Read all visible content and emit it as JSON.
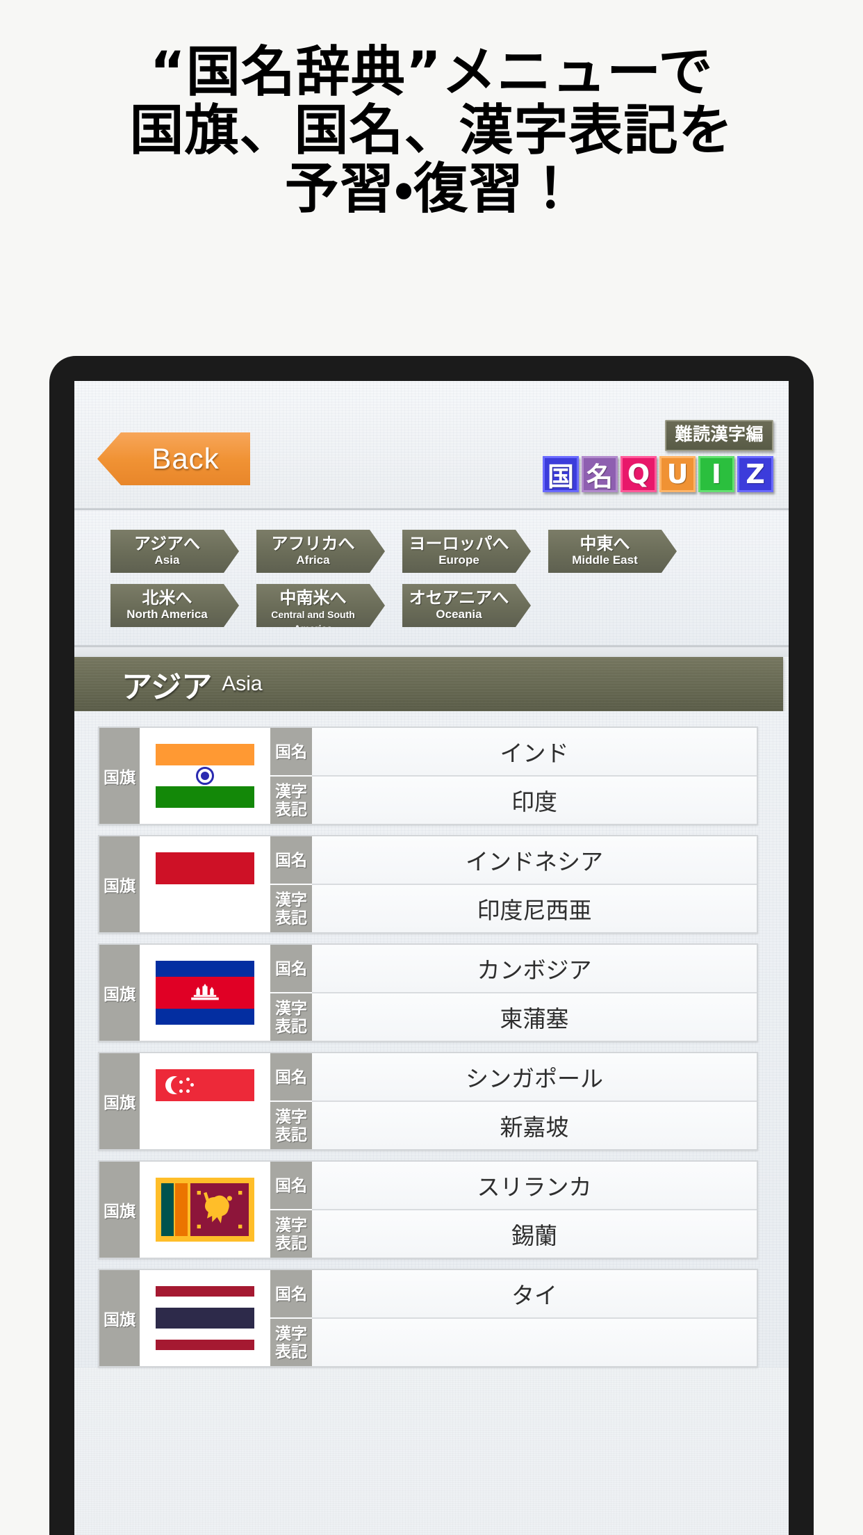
{
  "headline": {
    "line1": "“国名辞典”メニューで",
    "line2": "国旗、国名、漢字表記を",
    "line3": "予習・復習！"
  },
  "app": {
    "back_label": "Back",
    "mode_badge": "難読漢字編",
    "logo_tiles": [
      {
        "char": "国",
        "bg": "#3c3cdb",
        "border": "#6a6aff"
      },
      {
        "char": "名",
        "bg": "#8e5fb0",
        "border": "#b189cc"
      },
      {
        "char": "Q",
        "bg": "#e8176a",
        "border": "#ff5a9a"
      },
      {
        "char": "U",
        "bg": "#f09234",
        "border": "#ffb569"
      },
      {
        "char": "I",
        "bg": "#2bbf3e",
        "border": "#63e070"
      },
      {
        "char": "Z",
        "bg": "#3c3cdb",
        "border": "#6a6aff"
      }
    ]
  },
  "region_nav": {
    "row1": [
      {
        "jp": "アジアへ",
        "en": "Asia"
      },
      {
        "jp": "アフリカへ",
        "en": "Africa"
      },
      {
        "jp": "ヨーロッパへ",
        "en": "Europe"
      },
      {
        "jp": "中東へ",
        "en": "Middle East"
      }
    ],
    "row2": [
      {
        "jp": "北米へ",
        "en": "North America"
      },
      {
        "jp": "中南米へ",
        "en": "Central and South America"
      },
      {
        "jp": "オセアニアへ",
        "en": "Oceania"
      }
    ]
  },
  "section": {
    "jp": "アジア",
    "en": "Asia"
  },
  "labels": {
    "flag": "国旗",
    "country_name": "国名",
    "kanji": "漢字\n表記",
    "kanji_line1": "漢字",
    "kanji_line2": "表記"
  },
  "countries": [
    {
      "flag_id": "india-flag",
      "name": "インド",
      "kanji": "印度"
    },
    {
      "flag_id": "indonesia-flag",
      "name": "インドネシア",
      "kanji": "印度尼西亜"
    },
    {
      "flag_id": "cambodia-flag",
      "name": "カンボジア",
      "kanji": "柬蒲塞"
    },
    {
      "flag_id": "singapore-flag",
      "name": "シンガポール",
      "kanji": "新嘉坡"
    },
    {
      "flag_id": "srilanka-flag",
      "name": "スリランカ",
      "kanji": "錫蘭"
    },
    {
      "flag_id": "thailand-flag",
      "name": "タイ",
      "kanji": ""
    }
  ],
  "colors": {
    "accent_orange": "#f09234",
    "banner_olive": "#656751",
    "label_gray": "#a7a7a2",
    "phone_bezel": "#1b1b1b",
    "page_bg": "#f7f7f5"
  }
}
